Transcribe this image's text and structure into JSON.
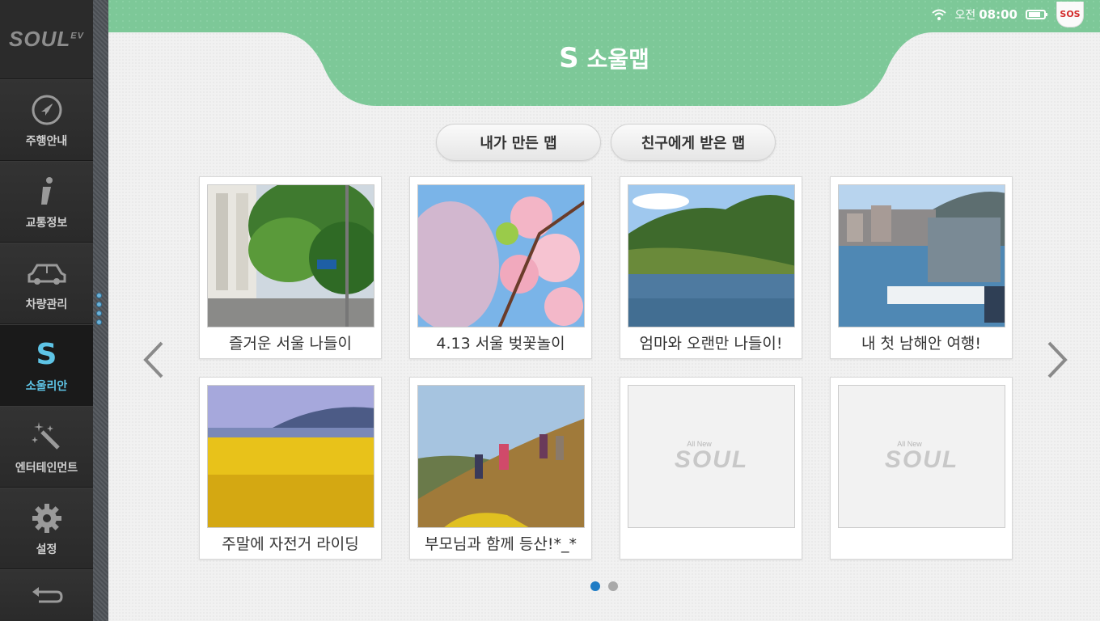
{
  "sidebar": {
    "logo": "SOUL",
    "logo_suffix": "EV",
    "items": [
      {
        "label": "주행안내",
        "icon": "navigation-icon"
      },
      {
        "label": "교통정보",
        "icon": "info-icon"
      },
      {
        "label": "차량관리",
        "icon": "car-icon"
      },
      {
        "label": "소울리안",
        "icon": "s-logo-icon",
        "active": true
      },
      {
        "label": "엔터테인먼트",
        "icon": "magic-wand-icon"
      },
      {
        "label": "설정",
        "icon": "gear-icon"
      }
    ],
    "back_icon": "back-arrow-icon"
  },
  "status": {
    "period": "오전",
    "time": "08:00",
    "sos": "SOS"
  },
  "header": {
    "logo": "S",
    "title": "소울맵"
  },
  "tabs": [
    {
      "label": "내가 만든 맵"
    },
    {
      "label": "친구에게 받은 맵"
    }
  ],
  "cards": [
    {
      "caption": "즐거운 서울 나들이"
    },
    {
      "caption": "4.13 서울 벚꽃놀이"
    },
    {
      "caption": "엄마와 오랜만 나들이!"
    },
    {
      "caption": "내 첫 남해안 여행!"
    },
    {
      "caption": "주말에 자전거 라이딩"
    },
    {
      "caption": "부모님과 함께 등산!*_*"
    },
    {
      "caption": "",
      "placeholder_small": "All New",
      "placeholder": "SOUL"
    },
    {
      "caption": "",
      "placeholder_small": "All New",
      "placeholder": "SOUL"
    }
  ],
  "pager": {
    "pages": 2,
    "current": 1
  },
  "colors": {
    "header_green": "#7dc898",
    "active_blue": "#5ec4e6",
    "pager_active": "#1f7cc5"
  }
}
